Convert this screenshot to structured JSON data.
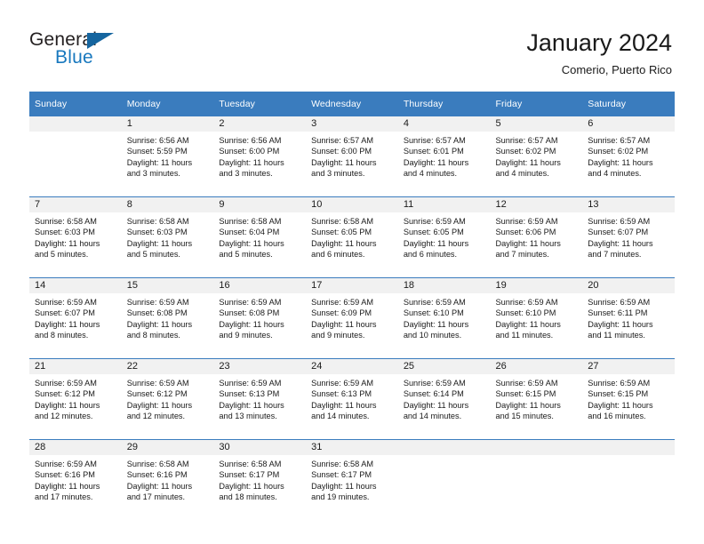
{
  "brand": {
    "name_top": "General",
    "name_bottom": "Blue",
    "triangle_color": "#15659f",
    "blue_color": "#1878be"
  },
  "header": {
    "title": "January 2024",
    "subtitle": "Comerio, Puerto Rico",
    "header_bg": "#3a7cbe",
    "daynum_bg": "#f1f1f1"
  },
  "weekday_headers": [
    "Sunday",
    "Monday",
    "Tuesday",
    "Wednesday",
    "Thursday",
    "Friday",
    "Saturday"
  ],
  "weeks": [
    [
      {
        "day": "",
        "sunrise": "",
        "sunset": "",
        "daylight_line1": "",
        "daylight_line2": ""
      },
      {
        "day": "1",
        "sunrise": "Sunrise: 6:56 AM",
        "sunset": "Sunset: 5:59 PM",
        "daylight_line1": "Daylight: 11 hours",
        "daylight_line2": "and 3 minutes."
      },
      {
        "day": "2",
        "sunrise": "Sunrise: 6:56 AM",
        "sunset": "Sunset: 6:00 PM",
        "daylight_line1": "Daylight: 11 hours",
        "daylight_line2": "and 3 minutes."
      },
      {
        "day": "3",
        "sunrise": "Sunrise: 6:57 AM",
        "sunset": "Sunset: 6:00 PM",
        "daylight_line1": "Daylight: 11 hours",
        "daylight_line2": "and 3 minutes."
      },
      {
        "day": "4",
        "sunrise": "Sunrise: 6:57 AM",
        "sunset": "Sunset: 6:01 PM",
        "daylight_line1": "Daylight: 11 hours",
        "daylight_line2": "and 4 minutes."
      },
      {
        "day": "5",
        "sunrise": "Sunrise: 6:57 AM",
        "sunset": "Sunset: 6:02 PM",
        "daylight_line1": "Daylight: 11 hours",
        "daylight_line2": "and 4 minutes."
      },
      {
        "day": "6",
        "sunrise": "Sunrise: 6:57 AM",
        "sunset": "Sunset: 6:02 PM",
        "daylight_line1": "Daylight: 11 hours",
        "daylight_line2": "and 4 minutes."
      }
    ],
    [
      {
        "day": "7",
        "sunrise": "Sunrise: 6:58 AM",
        "sunset": "Sunset: 6:03 PM",
        "daylight_line1": "Daylight: 11 hours",
        "daylight_line2": "and 5 minutes."
      },
      {
        "day": "8",
        "sunrise": "Sunrise: 6:58 AM",
        "sunset": "Sunset: 6:03 PM",
        "daylight_line1": "Daylight: 11 hours",
        "daylight_line2": "and 5 minutes."
      },
      {
        "day": "9",
        "sunrise": "Sunrise: 6:58 AM",
        "sunset": "Sunset: 6:04 PM",
        "daylight_line1": "Daylight: 11 hours",
        "daylight_line2": "and 5 minutes."
      },
      {
        "day": "10",
        "sunrise": "Sunrise: 6:58 AM",
        "sunset": "Sunset: 6:05 PM",
        "daylight_line1": "Daylight: 11 hours",
        "daylight_line2": "and 6 minutes."
      },
      {
        "day": "11",
        "sunrise": "Sunrise: 6:59 AM",
        "sunset": "Sunset: 6:05 PM",
        "daylight_line1": "Daylight: 11 hours",
        "daylight_line2": "and 6 minutes."
      },
      {
        "day": "12",
        "sunrise": "Sunrise: 6:59 AM",
        "sunset": "Sunset: 6:06 PM",
        "daylight_line1": "Daylight: 11 hours",
        "daylight_line2": "and 7 minutes."
      },
      {
        "day": "13",
        "sunrise": "Sunrise: 6:59 AM",
        "sunset": "Sunset: 6:07 PM",
        "daylight_line1": "Daylight: 11 hours",
        "daylight_line2": "and 7 minutes."
      }
    ],
    [
      {
        "day": "14",
        "sunrise": "Sunrise: 6:59 AM",
        "sunset": "Sunset: 6:07 PM",
        "daylight_line1": "Daylight: 11 hours",
        "daylight_line2": "and 8 minutes."
      },
      {
        "day": "15",
        "sunrise": "Sunrise: 6:59 AM",
        "sunset": "Sunset: 6:08 PM",
        "daylight_line1": "Daylight: 11 hours",
        "daylight_line2": "and 8 minutes."
      },
      {
        "day": "16",
        "sunrise": "Sunrise: 6:59 AM",
        "sunset": "Sunset: 6:08 PM",
        "daylight_line1": "Daylight: 11 hours",
        "daylight_line2": "and 9 minutes."
      },
      {
        "day": "17",
        "sunrise": "Sunrise: 6:59 AM",
        "sunset": "Sunset: 6:09 PM",
        "daylight_line1": "Daylight: 11 hours",
        "daylight_line2": "and 9 minutes."
      },
      {
        "day": "18",
        "sunrise": "Sunrise: 6:59 AM",
        "sunset": "Sunset: 6:10 PM",
        "daylight_line1": "Daylight: 11 hours",
        "daylight_line2": "and 10 minutes."
      },
      {
        "day": "19",
        "sunrise": "Sunrise: 6:59 AM",
        "sunset": "Sunset: 6:10 PM",
        "daylight_line1": "Daylight: 11 hours",
        "daylight_line2": "and 11 minutes."
      },
      {
        "day": "20",
        "sunrise": "Sunrise: 6:59 AM",
        "sunset": "Sunset: 6:11 PM",
        "daylight_line1": "Daylight: 11 hours",
        "daylight_line2": "and 11 minutes."
      }
    ],
    [
      {
        "day": "21",
        "sunrise": "Sunrise: 6:59 AM",
        "sunset": "Sunset: 6:12 PM",
        "daylight_line1": "Daylight: 11 hours",
        "daylight_line2": "and 12 minutes."
      },
      {
        "day": "22",
        "sunrise": "Sunrise: 6:59 AM",
        "sunset": "Sunset: 6:12 PM",
        "daylight_line1": "Daylight: 11 hours",
        "daylight_line2": "and 12 minutes."
      },
      {
        "day": "23",
        "sunrise": "Sunrise: 6:59 AM",
        "sunset": "Sunset: 6:13 PM",
        "daylight_line1": "Daylight: 11 hours",
        "daylight_line2": "and 13 minutes."
      },
      {
        "day": "24",
        "sunrise": "Sunrise: 6:59 AM",
        "sunset": "Sunset: 6:13 PM",
        "daylight_line1": "Daylight: 11 hours",
        "daylight_line2": "and 14 minutes."
      },
      {
        "day": "25",
        "sunrise": "Sunrise: 6:59 AM",
        "sunset": "Sunset: 6:14 PM",
        "daylight_line1": "Daylight: 11 hours",
        "daylight_line2": "and 14 minutes."
      },
      {
        "day": "26",
        "sunrise": "Sunrise: 6:59 AM",
        "sunset": "Sunset: 6:15 PM",
        "daylight_line1": "Daylight: 11 hours",
        "daylight_line2": "and 15 minutes."
      },
      {
        "day": "27",
        "sunrise": "Sunrise: 6:59 AM",
        "sunset": "Sunset: 6:15 PM",
        "daylight_line1": "Daylight: 11 hours",
        "daylight_line2": "and 16 minutes."
      }
    ],
    [
      {
        "day": "28",
        "sunrise": "Sunrise: 6:59 AM",
        "sunset": "Sunset: 6:16 PM",
        "daylight_line1": "Daylight: 11 hours",
        "daylight_line2": "and 17 minutes."
      },
      {
        "day": "29",
        "sunrise": "Sunrise: 6:58 AM",
        "sunset": "Sunset: 6:16 PM",
        "daylight_line1": "Daylight: 11 hours",
        "daylight_line2": "and 17 minutes."
      },
      {
        "day": "30",
        "sunrise": "Sunrise: 6:58 AM",
        "sunset": "Sunset: 6:17 PM",
        "daylight_line1": "Daylight: 11 hours",
        "daylight_line2": "and 18 minutes."
      },
      {
        "day": "31",
        "sunrise": "Sunrise: 6:58 AM",
        "sunset": "Sunset: 6:17 PM",
        "daylight_line1": "Daylight: 11 hours",
        "daylight_line2": "and 19 minutes."
      },
      {
        "day": "",
        "sunrise": "",
        "sunset": "",
        "daylight_line1": "",
        "daylight_line2": ""
      },
      {
        "day": "",
        "sunrise": "",
        "sunset": "",
        "daylight_line1": "",
        "daylight_line2": ""
      },
      {
        "day": "",
        "sunrise": "",
        "sunset": "",
        "daylight_line1": "",
        "daylight_line2": ""
      }
    ]
  ]
}
